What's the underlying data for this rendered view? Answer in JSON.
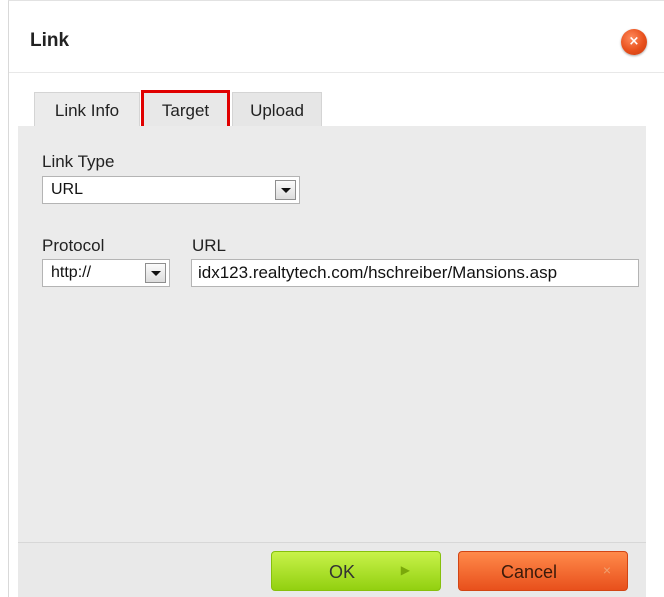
{
  "dialog": {
    "title": "Link",
    "close_icon": "×"
  },
  "tabs": [
    {
      "label": "Link Info"
    },
    {
      "label": "Target"
    },
    {
      "label": "Upload"
    }
  ],
  "form": {
    "link_type_label": "Link Type",
    "link_type_value": "URL",
    "protocol_label": "Protocol",
    "protocol_value": "http://",
    "url_label": "URL",
    "url_value": "idx123.realtytech.com/hschreiber/Mansions.asp"
  },
  "buttons": {
    "ok_label": "OK",
    "ok_icon": "▶",
    "cancel_label": "Cancel",
    "cancel_icon": "×"
  },
  "colors": {
    "highlight_border": "#e00000",
    "ok_green": "#a6dc1e",
    "cancel_orange": "#f26a2e",
    "close_orange": "#e8501c"
  }
}
